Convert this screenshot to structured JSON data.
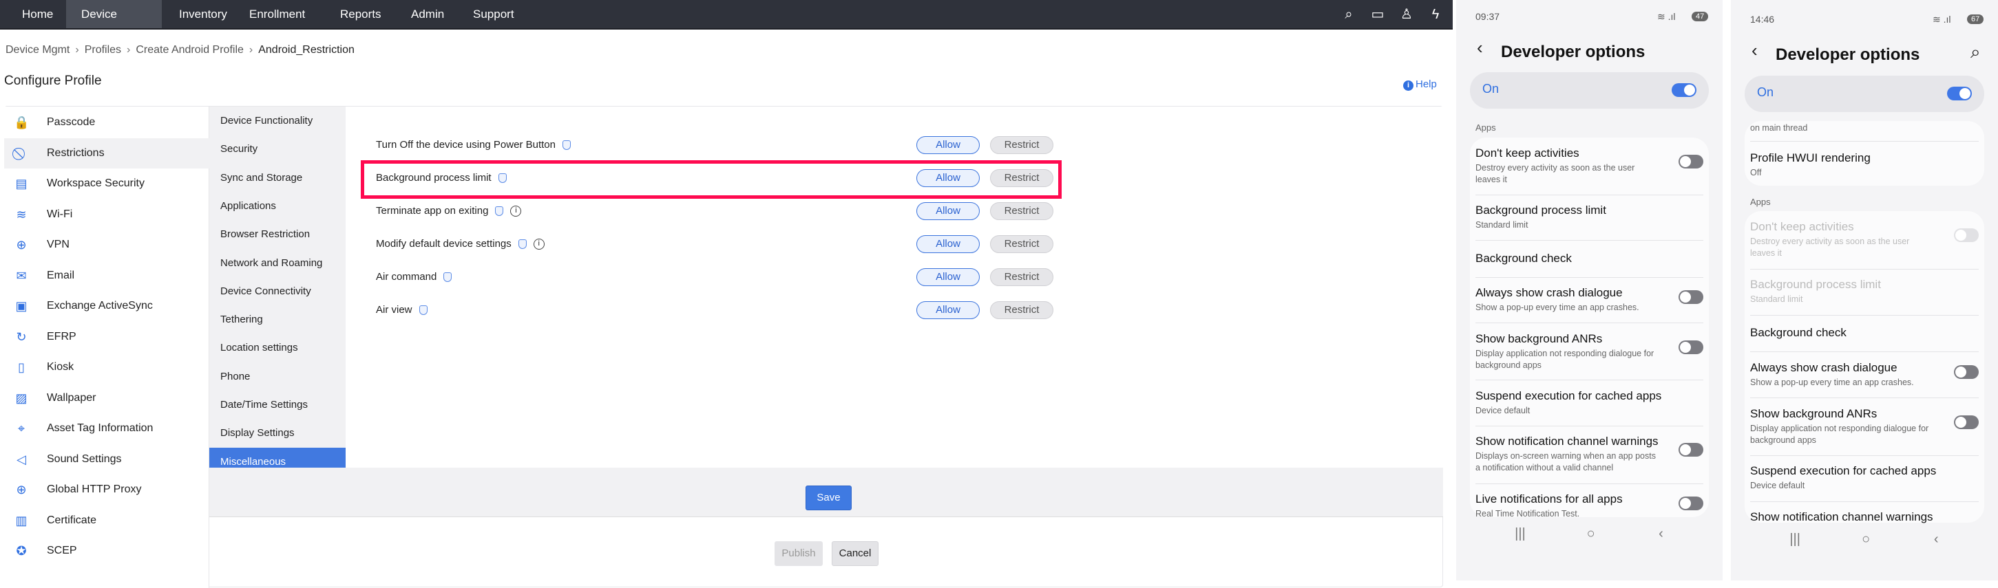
{
  "nav": {
    "items": [
      "Home",
      "Device Mgmt",
      "Inventory",
      "Enrollment",
      "Reports",
      "Admin",
      "Support"
    ],
    "active": "Device Mgmt",
    "icons": [
      "search-icon",
      "video-icon",
      "rocket-icon",
      "bolt-icon"
    ]
  },
  "breadcrumb": [
    "Device Mgmt",
    "Profiles",
    "Create Android Profile",
    "Android_Restriction"
  ],
  "page_title": "Configure Profile",
  "help_label": "Help",
  "left_menu": [
    "Passcode",
    "Restrictions",
    "Workspace Security",
    "Wi-Fi",
    "VPN",
    "Email",
    "Exchange ActiveSync",
    "EFRP",
    "Kiosk",
    "Wallpaper",
    "Asset Tag Information",
    "Sound Settings",
    "Global HTTP Proxy",
    "Certificate",
    "SCEP"
  ],
  "left_selected": "Restrictions",
  "sub_menu": [
    "Device Functionality",
    "Security",
    "Sync and Storage",
    "Applications",
    "Browser Restriction",
    "Network and Roaming",
    "Device Connectivity",
    "Tethering",
    "Location settings",
    "Phone",
    "Date/Time Settings",
    "Display Settings",
    "Miscellaneous"
  ],
  "sub_selected": "Miscellaneous",
  "settings": [
    {
      "label": "Turn Off the device using Power Button",
      "info": false
    },
    {
      "label": "Background process limit",
      "info": false,
      "highlighted": true
    },
    {
      "label": "Terminate app on exiting",
      "info": true
    },
    {
      "label": "Modify default device settings",
      "info": true
    },
    {
      "label": "Air command",
      "info": false
    },
    {
      "label": "Air view",
      "info": false
    }
  ],
  "allow_label": "Allow",
  "restrict_label": "Restrict",
  "save_label": "Save",
  "publish_label": "Publish",
  "cancel_label": "Cancel",
  "colors": {
    "accent": "#3f7ae2",
    "highlight": "#ff0a50",
    "nav_bg": "#2f323b"
  },
  "phone1": {
    "time": "09:37",
    "battery": "47",
    "title": "Developer options",
    "on_label": "On",
    "section": "Apps",
    "items": [
      {
        "title": "Don't keep activities",
        "sub": "Destroy every activity as soon as the user leaves it",
        "toggle": "off"
      },
      {
        "title": "Background process limit",
        "sub": "Standard limit"
      },
      {
        "title": "Background check"
      },
      {
        "title": "Always show crash dialogue",
        "sub": "Show a pop-up every time an app crashes.",
        "toggle": "off"
      },
      {
        "title": "Show background ANRs",
        "sub": "Display application not responding dialogue for background apps",
        "toggle": "off"
      },
      {
        "title": "Suspend execution for cached apps",
        "sub": "Device default"
      },
      {
        "title": "Show notification channel warnings",
        "sub": "Displays on-screen warning when an app posts a notification without a valid channel",
        "toggle": "off"
      },
      {
        "title": "Live notifications for all apps",
        "sub": "Real Time Notification Test.",
        "toggle": "off"
      }
    ]
  },
  "phone2": {
    "time": "14:46",
    "battery": "67",
    "title": "Developer options",
    "on_label": "On",
    "cut_text": "on main thread",
    "hwui_title": "Profile HWUI rendering",
    "hwui_sub": "Off",
    "section": "Apps",
    "items": [
      {
        "title": "Don't keep activities",
        "sub": "Destroy every activity as soon as the user leaves it",
        "toggle": "disabled"
      },
      {
        "title": "Background process limit",
        "sub": "Standard limit",
        "disabled": true
      },
      {
        "title": "Background check"
      },
      {
        "title": "Always show crash dialogue",
        "sub": "Show a pop-up every time an app crashes.",
        "toggle": "off"
      },
      {
        "title": "Show background ANRs",
        "sub": "Display application not responding dialogue for background apps",
        "toggle": "off"
      },
      {
        "title": "Suspend execution for cached apps",
        "sub": "Device default"
      },
      {
        "title": "Show notification channel warnings"
      }
    ]
  }
}
